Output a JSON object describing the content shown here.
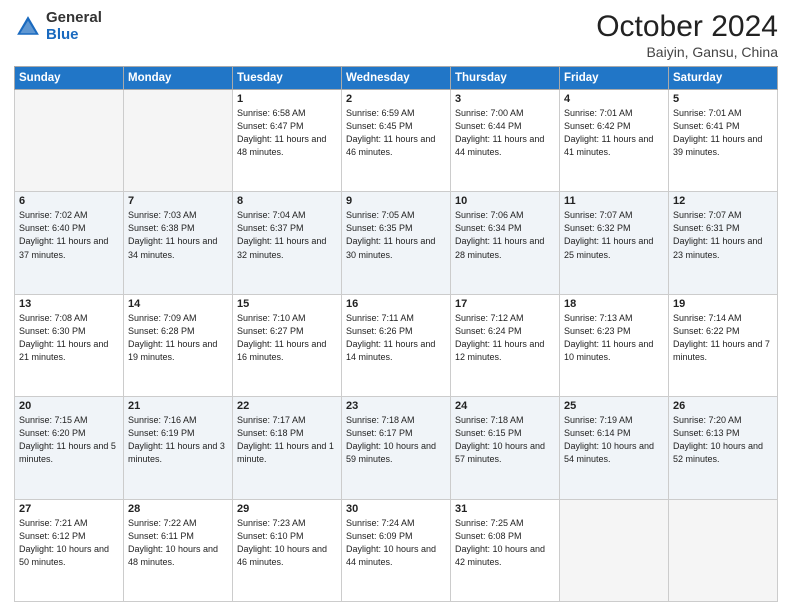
{
  "header": {
    "logo": {
      "line1": "General",
      "line2": "Blue"
    },
    "month": "October 2024",
    "location": "Baiyin, Gansu, China"
  },
  "weekdays": [
    "Sunday",
    "Monday",
    "Tuesday",
    "Wednesday",
    "Thursday",
    "Friday",
    "Saturday"
  ],
  "weeks": [
    [
      {
        "num": "",
        "info": ""
      },
      {
        "num": "",
        "info": ""
      },
      {
        "num": "1",
        "info": "Sunrise: 6:58 AM\nSunset: 6:47 PM\nDaylight: 11 hours and 48 minutes."
      },
      {
        "num": "2",
        "info": "Sunrise: 6:59 AM\nSunset: 6:45 PM\nDaylight: 11 hours and 46 minutes."
      },
      {
        "num": "3",
        "info": "Sunrise: 7:00 AM\nSunset: 6:44 PM\nDaylight: 11 hours and 44 minutes."
      },
      {
        "num": "4",
        "info": "Sunrise: 7:01 AM\nSunset: 6:42 PM\nDaylight: 11 hours and 41 minutes."
      },
      {
        "num": "5",
        "info": "Sunrise: 7:01 AM\nSunset: 6:41 PM\nDaylight: 11 hours and 39 minutes."
      }
    ],
    [
      {
        "num": "6",
        "info": "Sunrise: 7:02 AM\nSunset: 6:40 PM\nDaylight: 11 hours and 37 minutes."
      },
      {
        "num": "7",
        "info": "Sunrise: 7:03 AM\nSunset: 6:38 PM\nDaylight: 11 hours and 34 minutes."
      },
      {
        "num": "8",
        "info": "Sunrise: 7:04 AM\nSunset: 6:37 PM\nDaylight: 11 hours and 32 minutes."
      },
      {
        "num": "9",
        "info": "Sunrise: 7:05 AM\nSunset: 6:35 PM\nDaylight: 11 hours and 30 minutes."
      },
      {
        "num": "10",
        "info": "Sunrise: 7:06 AM\nSunset: 6:34 PM\nDaylight: 11 hours and 28 minutes."
      },
      {
        "num": "11",
        "info": "Sunrise: 7:07 AM\nSunset: 6:32 PM\nDaylight: 11 hours and 25 minutes."
      },
      {
        "num": "12",
        "info": "Sunrise: 7:07 AM\nSunset: 6:31 PM\nDaylight: 11 hours and 23 minutes."
      }
    ],
    [
      {
        "num": "13",
        "info": "Sunrise: 7:08 AM\nSunset: 6:30 PM\nDaylight: 11 hours and 21 minutes."
      },
      {
        "num": "14",
        "info": "Sunrise: 7:09 AM\nSunset: 6:28 PM\nDaylight: 11 hours and 19 minutes."
      },
      {
        "num": "15",
        "info": "Sunrise: 7:10 AM\nSunset: 6:27 PM\nDaylight: 11 hours and 16 minutes."
      },
      {
        "num": "16",
        "info": "Sunrise: 7:11 AM\nSunset: 6:26 PM\nDaylight: 11 hours and 14 minutes."
      },
      {
        "num": "17",
        "info": "Sunrise: 7:12 AM\nSunset: 6:24 PM\nDaylight: 11 hours and 12 minutes."
      },
      {
        "num": "18",
        "info": "Sunrise: 7:13 AM\nSunset: 6:23 PM\nDaylight: 11 hours and 10 minutes."
      },
      {
        "num": "19",
        "info": "Sunrise: 7:14 AM\nSunset: 6:22 PM\nDaylight: 11 hours and 7 minutes."
      }
    ],
    [
      {
        "num": "20",
        "info": "Sunrise: 7:15 AM\nSunset: 6:20 PM\nDaylight: 11 hours and 5 minutes."
      },
      {
        "num": "21",
        "info": "Sunrise: 7:16 AM\nSunset: 6:19 PM\nDaylight: 11 hours and 3 minutes."
      },
      {
        "num": "22",
        "info": "Sunrise: 7:17 AM\nSunset: 6:18 PM\nDaylight: 11 hours and 1 minute."
      },
      {
        "num": "23",
        "info": "Sunrise: 7:18 AM\nSunset: 6:17 PM\nDaylight: 10 hours and 59 minutes."
      },
      {
        "num": "24",
        "info": "Sunrise: 7:18 AM\nSunset: 6:15 PM\nDaylight: 10 hours and 57 minutes."
      },
      {
        "num": "25",
        "info": "Sunrise: 7:19 AM\nSunset: 6:14 PM\nDaylight: 10 hours and 54 minutes."
      },
      {
        "num": "26",
        "info": "Sunrise: 7:20 AM\nSunset: 6:13 PM\nDaylight: 10 hours and 52 minutes."
      }
    ],
    [
      {
        "num": "27",
        "info": "Sunrise: 7:21 AM\nSunset: 6:12 PM\nDaylight: 10 hours and 50 minutes."
      },
      {
        "num": "28",
        "info": "Sunrise: 7:22 AM\nSunset: 6:11 PM\nDaylight: 10 hours and 48 minutes."
      },
      {
        "num": "29",
        "info": "Sunrise: 7:23 AM\nSunset: 6:10 PM\nDaylight: 10 hours and 46 minutes."
      },
      {
        "num": "30",
        "info": "Sunrise: 7:24 AM\nSunset: 6:09 PM\nDaylight: 10 hours and 44 minutes."
      },
      {
        "num": "31",
        "info": "Sunrise: 7:25 AM\nSunset: 6:08 PM\nDaylight: 10 hours and 42 minutes."
      },
      {
        "num": "",
        "info": ""
      },
      {
        "num": "",
        "info": ""
      }
    ]
  ]
}
